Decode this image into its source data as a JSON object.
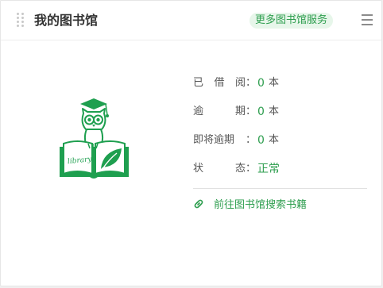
{
  "header": {
    "title": "我的图书馆",
    "more_label": "更多图书馆服务"
  },
  "logo": {
    "book_text": "library",
    "icon": "owl-library-logo",
    "accent_color": "#1e9f4f"
  },
  "stats": {
    "borrowed": {
      "label_chars": [
        "已",
        "借",
        "阅"
      ],
      "colon": "：",
      "value": "0",
      "unit": "本"
    },
    "overdue": {
      "label_chars": [
        "逾",
        "期"
      ],
      "colon": "：",
      "value": "0",
      "unit": "本"
    },
    "due_soon": {
      "label": "即将逾期",
      "colon": "：",
      "value": "0",
      "unit": "本"
    },
    "status": {
      "label_chars": [
        "状",
        "态"
      ],
      "colon": "：",
      "value": "正常"
    }
  },
  "search_link": {
    "icon": "link-icon",
    "label": "前往图书馆搜索书籍"
  },
  "colors": {
    "accent": "#2e9e4f",
    "badge_bg": "#e7f6ea"
  }
}
